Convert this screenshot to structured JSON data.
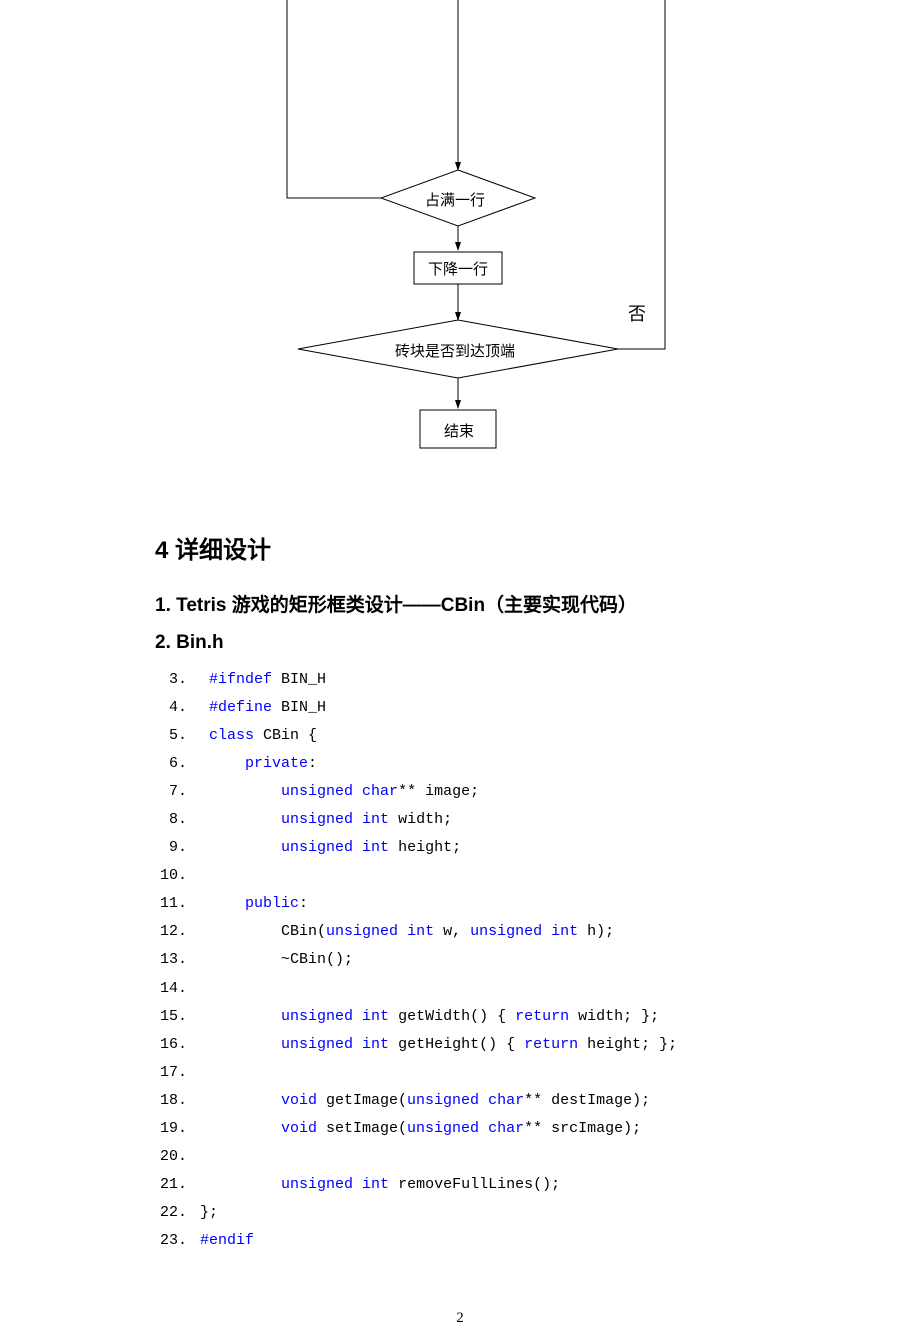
{
  "flowchart": {
    "diamond1": "占满一行",
    "box1": "下降一行",
    "diamond2": "砖块是否到达顶端",
    "box2": "结束",
    "label_no": "否"
  },
  "headings": {
    "section4": "4 详细设计",
    "sub1": "1. Tetris 游戏的矩形框类设计——CBin（主要实现代码）",
    "sub2": "2. Bin.h"
  },
  "code": [
    {
      "n": "3.",
      "tokens": [
        {
          "t": "  ",
          "c": "plain"
        },
        {
          "t": "#ifndef",
          "c": "pp"
        },
        {
          "t": " BIN_H",
          "c": "plain"
        }
      ]
    },
    {
      "n": "4.",
      "tokens": [
        {
          "t": "  ",
          "c": "plain"
        },
        {
          "t": "#define",
          "c": "pp"
        },
        {
          "t": " BIN_H",
          "c": "plain"
        }
      ]
    },
    {
      "n": "5.",
      "tokens": [
        {
          "t": "  ",
          "c": "plain"
        },
        {
          "t": "class",
          "c": "kw"
        },
        {
          "t": " CBin {",
          "c": "plain"
        }
      ]
    },
    {
      "n": "6.",
      "tokens": [
        {
          "t": "      ",
          "c": "plain"
        },
        {
          "t": "private",
          "c": "kw"
        },
        {
          "t": ":",
          "c": "plain"
        }
      ]
    },
    {
      "n": "7.",
      "tokens": [
        {
          "t": "          ",
          "c": "plain"
        },
        {
          "t": "unsigned",
          "c": "kw"
        },
        {
          "t": " ",
          "c": "plain"
        },
        {
          "t": "char",
          "c": "kw"
        },
        {
          "t": "** image;",
          "c": "plain"
        }
      ]
    },
    {
      "n": "8.",
      "tokens": [
        {
          "t": "          ",
          "c": "plain"
        },
        {
          "t": "unsigned",
          "c": "kw"
        },
        {
          "t": " ",
          "c": "plain"
        },
        {
          "t": "int",
          "c": "kw"
        },
        {
          "t": " width;",
          "c": "plain"
        }
      ]
    },
    {
      "n": "9.",
      "tokens": [
        {
          "t": "          ",
          "c": "plain"
        },
        {
          "t": "unsigned",
          "c": "kw"
        },
        {
          "t": " ",
          "c": "plain"
        },
        {
          "t": "int",
          "c": "kw"
        },
        {
          "t": " height;",
          "c": "plain"
        }
      ]
    },
    {
      "n": "10.",
      "tokens": []
    },
    {
      "n": "11.",
      "tokens": [
        {
          "t": "      ",
          "c": "plain"
        },
        {
          "t": "public",
          "c": "kw"
        },
        {
          "t": ":",
          "c": "plain"
        }
      ]
    },
    {
      "n": "12.",
      "tokens": [
        {
          "t": "          CBin(",
          "c": "plain"
        },
        {
          "t": "unsigned",
          "c": "kw"
        },
        {
          "t": " ",
          "c": "plain"
        },
        {
          "t": "int",
          "c": "kw"
        },
        {
          "t": " w, ",
          "c": "plain"
        },
        {
          "t": "unsigned",
          "c": "kw"
        },
        {
          "t": " ",
          "c": "plain"
        },
        {
          "t": "int",
          "c": "kw"
        },
        {
          "t": " h);",
          "c": "plain"
        }
      ]
    },
    {
      "n": "13.",
      "tokens": [
        {
          "t": "          ~CBin();",
          "c": "plain"
        }
      ]
    },
    {
      "n": "14.",
      "tokens": []
    },
    {
      "n": "15.",
      "tokens": [
        {
          "t": "          ",
          "c": "plain"
        },
        {
          "t": "unsigned",
          "c": "kw"
        },
        {
          "t": " ",
          "c": "plain"
        },
        {
          "t": "int",
          "c": "kw"
        },
        {
          "t": " getWidth() { ",
          "c": "plain"
        },
        {
          "t": "return",
          "c": "kw"
        },
        {
          "t": " width; };",
          "c": "plain"
        }
      ]
    },
    {
      "n": "16.",
      "tokens": [
        {
          "t": "          ",
          "c": "plain"
        },
        {
          "t": "unsigned",
          "c": "kw"
        },
        {
          "t": " ",
          "c": "plain"
        },
        {
          "t": "int",
          "c": "kw"
        },
        {
          "t": " getHeight() { ",
          "c": "plain"
        },
        {
          "t": "return",
          "c": "kw"
        },
        {
          "t": " height; };",
          "c": "plain"
        }
      ]
    },
    {
      "n": "17.",
      "tokens": []
    },
    {
      "n": "18.",
      "tokens": [
        {
          "t": "          ",
          "c": "plain"
        },
        {
          "t": "void",
          "c": "kw"
        },
        {
          "t": " getImage(",
          "c": "plain"
        },
        {
          "t": "unsigned",
          "c": "kw"
        },
        {
          "t": " ",
          "c": "plain"
        },
        {
          "t": "char",
          "c": "kw"
        },
        {
          "t": "** destImage);",
          "c": "plain"
        }
      ]
    },
    {
      "n": "19.",
      "tokens": [
        {
          "t": "          ",
          "c": "plain"
        },
        {
          "t": "void",
          "c": "kw"
        },
        {
          "t": " setImage(",
          "c": "plain"
        },
        {
          "t": "unsigned",
          "c": "kw"
        },
        {
          "t": " ",
          "c": "plain"
        },
        {
          "t": "char",
          "c": "kw"
        },
        {
          "t": "** srcImage);",
          "c": "plain"
        }
      ]
    },
    {
      "n": "20.",
      "tokens": []
    },
    {
      "n": "21.",
      "tokens": [
        {
          "t": "          ",
          "c": "plain"
        },
        {
          "t": "unsigned",
          "c": "kw"
        },
        {
          "t": " ",
          "c": "plain"
        },
        {
          "t": "int",
          "c": "kw"
        },
        {
          "t": " removeFullLines();",
          "c": "plain"
        }
      ]
    },
    {
      "n": "22.",
      "tokens": [
        {
          "t": " };",
          "c": "plain"
        }
      ]
    },
    {
      "n": "23.",
      "tokens": [
        {
          "t": " ",
          "c": "plain"
        },
        {
          "t": "#endif",
          "c": "pp"
        }
      ]
    }
  ],
  "page_number": "2"
}
